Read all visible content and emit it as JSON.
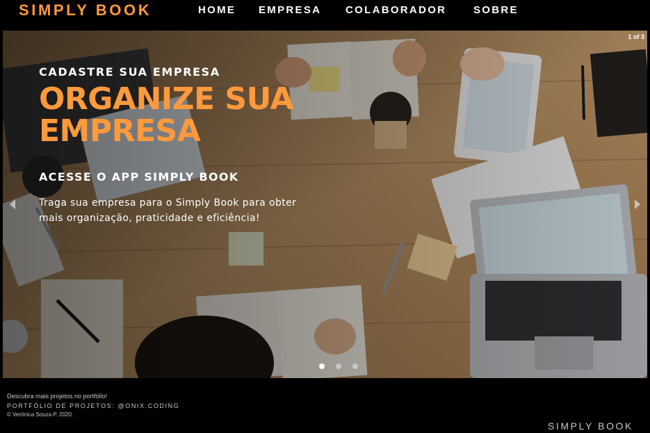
{
  "header": {
    "logo": "SIMPLY BOOK",
    "nav": [
      "HOME",
      "EMPRESA",
      "COLABORADOR",
      "SOBRE"
    ]
  },
  "carousel": {
    "counter": "1 of 3",
    "current_slide": 1,
    "total_slides": 3,
    "slide": {
      "kicker": "CADASTRE SUA EMPRESA",
      "title": "ORGANIZE SUA EMPRESA",
      "subtitle": "ACESSE O APP SIMPLY BOOK",
      "text": "Traga sua empresa para o Simply Book para obter mais organização, praticidade e eficiência!"
    },
    "icons": {
      "prev": "chevron-left-icon",
      "next": "chevron-right-icon"
    }
  },
  "footer": {
    "line1": "Descubra mais projetos no portfólio!",
    "line2": "PORTFÓLIO DE PROJETOS: @ONIX.CODING",
    "line3": "© Verônica Souza P. 2020.",
    "brand": "SIMPLY BOOK"
  },
  "colors": {
    "accent": "#ff9a3c",
    "background": "#000000",
    "text": "#ffffff",
    "footer_text": "#c8c8c8"
  }
}
